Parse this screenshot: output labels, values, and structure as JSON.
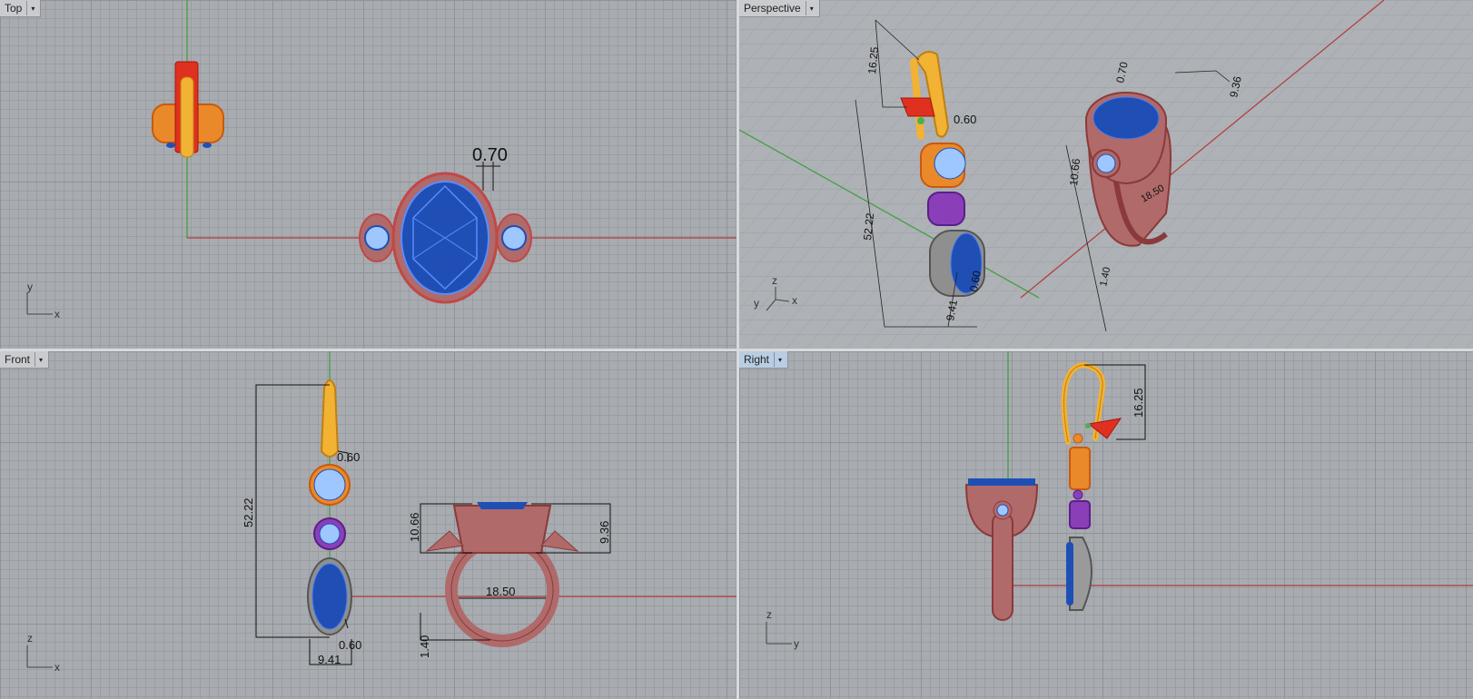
{
  "viewports": {
    "top": {
      "label": "Top"
    },
    "perspective": {
      "label": "Perspective"
    },
    "front": {
      "label": "Front"
    },
    "right": {
      "label": "Right"
    }
  },
  "dropdown_glyph": "▾",
  "dimensions": {
    "top": {
      "prong_gap": "0.70"
    },
    "perspective": {
      "hook_height": "16.25",
      "wall": "0.60",
      "total_length": "52.22",
      "width": "9.41",
      "setting_wall": "0.60",
      "bezel_wall": "0.70",
      "ring_top": "9.36",
      "ring_height": "10.66",
      "ring_size": "18.50",
      "shank": "1.40"
    },
    "front": {
      "wall_top": "0.60",
      "total_length": "52.22",
      "wall_bottom": "0.60",
      "width": "9.41",
      "ring_height": "10.66",
      "ring_top": "9.36",
      "ring_size": "18.50",
      "shank": "1.40"
    },
    "right": {
      "hook_height": "16.25"
    }
  },
  "axes": {
    "top": {
      "v": "y",
      "h": "x"
    },
    "perspective": {
      "a": "y",
      "b": "z",
      "c": "x"
    },
    "front": {
      "v": "z",
      "h": "x"
    },
    "right": {
      "v": "z",
      "h": "y"
    }
  },
  "colors": {
    "ring_metal": "#b06a6a",
    "ring_outline": "#c04848",
    "gem_blue": "#1f4fb5",
    "gem_light": "#9fc7ff",
    "gold": "#f2b233",
    "orange": "#e9892a",
    "purple": "#8a3fb8",
    "silver": "#9a9a9a",
    "red_part": "#e03020",
    "axis_x": "#b23a3a",
    "axis_y": "#3aa03a"
  }
}
